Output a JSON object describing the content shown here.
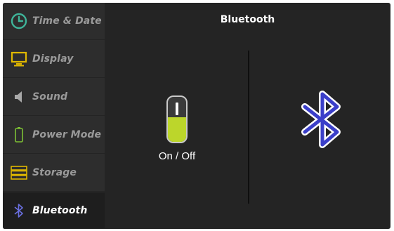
{
  "sidebar": {
    "items": [
      {
        "label": "Time & Date",
        "icon": "clock-icon"
      },
      {
        "label": "Display",
        "icon": "monitor-icon"
      },
      {
        "label": "Sound",
        "icon": "speaker-icon"
      },
      {
        "label": "Power Mode",
        "icon": "battery-icon"
      },
      {
        "label": "Storage",
        "icon": "storage-icon"
      },
      {
        "label": "Bluetooth",
        "icon": "bluetooth-icon",
        "active": true
      }
    ]
  },
  "main": {
    "title": "Bluetooth",
    "toggle": {
      "label": "On / Off",
      "state": "on"
    },
    "icon": "bluetooth-icon"
  },
  "colors": {
    "accent_green": "#bcd62b",
    "clock_teal": "#3fb59a",
    "display_yellow": "#e0b800",
    "bluetooth_blue": "#3b3fc9",
    "background": "#242424"
  }
}
